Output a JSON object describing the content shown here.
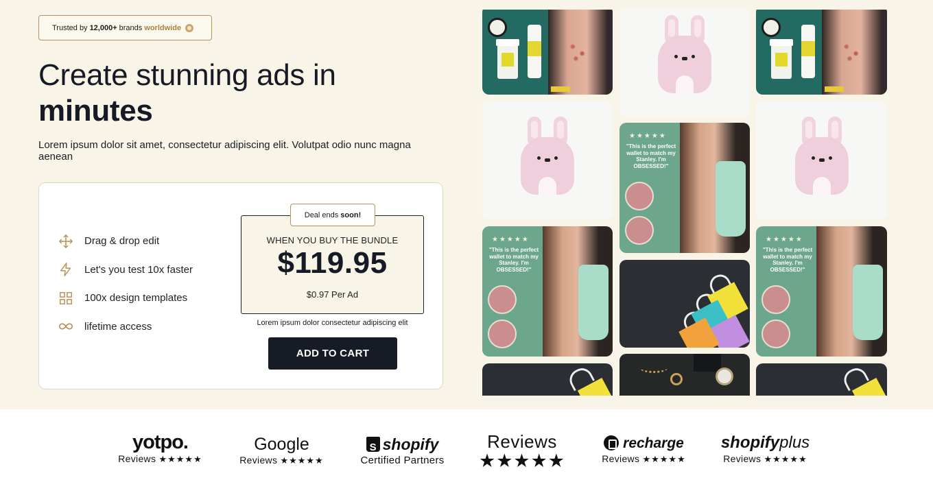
{
  "trust_badge": {
    "prefix": "Trusted by",
    "count": "12,000+",
    "suffix": "brands",
    "accent": "worldwide"
  },
  "hero": {
    "headline_line1": "Create stunning ads in",
    "headline_line2": "minutes",
    "subtext": "Lorem ipsum dolor sit amet, consectetur adipiscing elit. Volutpat odio nunc magna aenean"
  },
  "features": [
    {
      "icon": "move-arrows-icon",
      "label": "Drag & drop edit"
    },
    {
      "icon": "lightning-icon",
      "label": "Let's you test 10x faster"
    },
    {
      "icon": "grid-icon",
      "label": "100x design templates"
    },
    {
      "icon": "infinity-icon",
      "label": "lifetime access"
    }
  ],
  "offer": {
    "deal_prefix": "Deal ends",
    "deal_bold": "soon!",
    "bundle_label": "WHEN YOU BUY THE BUNDLE",
    "price": "$119.95",
    "per_ad": "$0.97 Per Ad",
    "fine_print": "Lorem ipsum dolor consectetur adipiscing elit",
    "cta": "ADD TO CART"
  },
  "gallery_tiles": [
    {
      "type": "skin",
      "stars": "",
      "quote": ""
    },
    {
      "type": "review",
      "stars": "★★★★★",
      "quote": "\"This is the perfect wallet to match my Stanley. I'm OBSESSED!\""
    }
  ],
  "logos": [
    {
      "brand": "yotpo.",
      "sub": "Reviews",
      "stars": "★★★★★"
    },
    {
      "brand": "Google",
      "sub": "Reviews",
      "stars": "★★★★★"
    },
    {
      "brand": "shopify",
      "sub": "Certified Partners",
      "stars": ""
    },
    {
      "brand": "Reviews",
      "sub": "",
      "stars": "★★★★★"
    },
    {
      "brand": "recharge",
      "sub": "Reviews",
      "stars": "★★★★★"
    },
    {
      "brand_a": "shopify",
      "brand_b": "plus",
      "sub": "Reviews",
      "stars": "★★★★★"
    }
  ],
  "colors": {
    "hero_bg": "#f8f4e7",
    "accent_gold": "#b8915a",
    "dark": "#161b26"
  }
}
